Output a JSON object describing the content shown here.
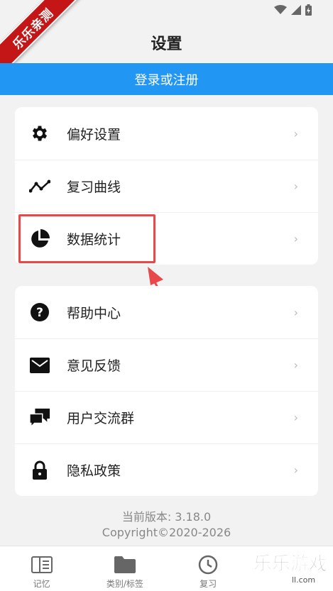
{
  "watermark_ribbon": "乐乐亲测",
  "header": {
    "title": "设置"
  },
  "login": {
    "label": "登录或注册"
  },
  "group1": [
    {
      "label": "偏好设置",
      "icon": "gear-icon"
    },
    {
      "label": "复习曲线",
      "icon": "trend-line-icon"
    },
    {
      "label": "数据统计",
      "icon": "pie-chart-icon"
    }
  ],
  "group2": [
    {
      "label": "帮助中心",
      "icon": "help-circle-icon"
    },
    {
      "label": "意见反馈",
      "icon": "mail-icon"
    },
    {
      "label": "用户交流群",
      "icon": "chat-icon"
    },
    {
      "label": "隐私政策",
      "icon": "lock-icon"
    }
  ],
  "chevron": "›",
  "footer": {
    "version": "当前版本: 3.18.0",
    "copyright": "Copyright©2020-2026"
  },
  "tabs": [
    {
      "label": "记忆",
      "icon": "book-icon"
    },
    {
      "label": "类别/标签",
      "icon": "folder-icon"
    },
    {
      "label": "复习",
      "icon": "clock-icon"
    }
  ],
  "watermark_logo": {
    "text": "乐乐游戏",
    "sub": "ll.com"
  },
  "colors": {
    "accent": "#2196f3",
    "highlight": "#e8484a",
    "ribbon": "#c41616"
  }
}
